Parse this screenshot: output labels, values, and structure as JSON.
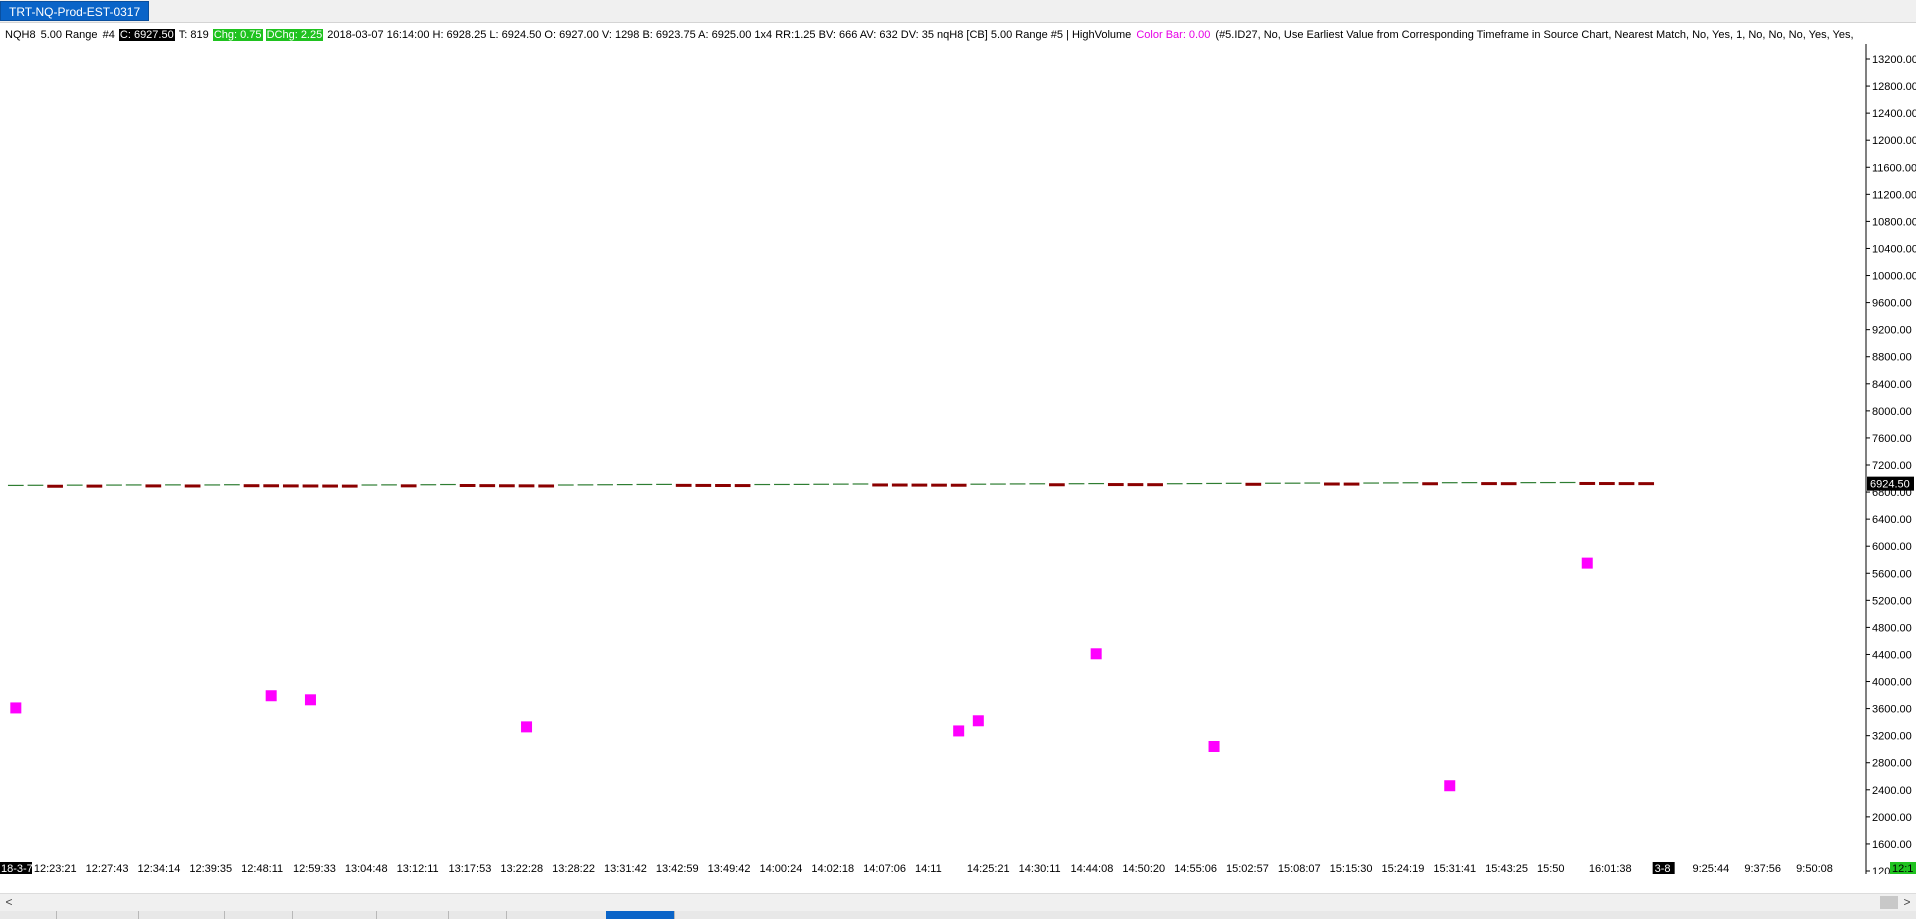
{
  "window": {
    "tab_title": "TRT-NQ-Prod-EST-0317"
  },
  "infoline": {
    "symbol": "NQH8",
    "range": "5.00 Range",
    "num": "#4",
    "close": "C: 6927.50",
    "ticks": "T: 819",
    "chg": "Chg: 0.75",
    "dchg": "DChg: 2.25",
    "details": "2018-03-07 16:14:00 H: 6928.25 L: 6924.50 O: 6927.00 V: 1298 B: 6923.75 A: 6925.00 1x4 RR:1.25 BV: 666 AV: 632 DV: 35 nqH8 [CB]  5.00 Range  #5 | HighVolume",
    "colorbar": "Color Bar: 0.00",
    "study": "(#5.ID27, No, Use Earliest Value from Corresponding Timeframe in Source Chart, Nearest Match, No, Yes, 1, No, No, No, Yes, Yes,"
  },
  "chart_data": {
    "type": "scatter",
    "ylim": [
      1200,
      13200
    ],
    "y_ticks": [
      "13200.00",
      "12800.00",
      "12400.00",
      "12000.00",
      "11600.00",
      "11200.00",
      "10800.00",
      "10400.00",
      "10000.00",
      "9600.00",
      "9200.00",
      "8800.00",
      "8400.00",
      "8000.00",
      "7600.00",
      "7200.00",
      "6800.00",
      "6400.00",
      "6000.00",
      "5600.00",
      "5200.00",
      "4800.00",
      "4400.00",
      "4000.00",
      "3600.00",
      "3200.00",
      "2800.00",
      "2400.00",
      "2000.00",
      "1600.00",
      "1200.00"
    ],
    "last_price_label": "6924.50",
    "last_price": 6924.5,
    "x_labels": [
      "18-3-7",
      "12:23:21",
      "12:27:43",
      "12:34:14",
      "12:39:35",
      "12:48:11",
      "12:59:33",
      "13:04:48",
      "13:12:11",
      "13:17:53",
      "13:22:28",
      "13:28:22",
      "13:31:42",
      "13:42:59",
      "13:49:42",
      "14:00:24",
      "14:02:18",
      "14:07:06",
      "14:11",
      "14:25:21",
      "14:30:11",
      "14:44:08",
      "14:50:20",
      "14:55:06",
      "15:02:57",
      "15:08:07",
      "15:15:30",
      "15:24:19",
      "15:31:41",
      "15:43:25",
      "15:50",
      "16:01:38",
      "3-8",
      "9:25:44",
      "9:37:56",
      "9:50:08",
      "12:1"
    ],
    "price_series": [
      6885,
      6887,
      6886,
      6889,
      6888,
      6890,
      6892,
      6891,
      6893,
      6890,
      6892,
      6895,
      6894,
      6893,
      6891,
      6890,
      6889,
      6888,
      6891,
      6893,
      6892,
      6895,
      6898,
      6897,
      6895,
      6893,
      6892,
      6890,
      6891,
      6893,
      6895,
      6897,
      6899,
      6900,
      6899,
      6898,
      6897,
      6896,
      6898,
      6899,
      6900,
      6902,
      6904,
      6906,
      6905,
      6904,
      6903,
      6902,
      6901,
      6903,
      6905,
      6907,
      6909,
      6908,
      6910,
      6912,
      6911,
      6910,
      6909,
      6910,
      6912,
      6914,
      6916,
      6915,
      6917,
      6918,
      6920,
      6919,
      6918,
      6920,
      6922,
      6924,
      6923,
      6925,
      6926,
      6925,
      6924,
      6926,
      6927,
      6928,
      6927,
      6926,
      6925,
      6924.5
    ],
    "markers": {
      "name": "HighVolume",
      "color": "#ff00ff",
      "points": [
        {
          "bar": 0,
          "y": 3610
        },
        {
          "bar": 13,
          "y": 3790
        },
        {
          "bar": 15,
          "y": 3730
        },
        {
          "bar": 26,
          "y": 3330
        },
        {
          "bar": 48,
          "y": 3270
        },
        {
          "bar": 49,
          "y": 3420
        },
        {
          "bar": 55,
          "y": 4410
        },
        {
          "bar": 61,
          "y": 3040
        },
        {
          "bar": 73,
          "y": 2460
        },
        {
          "bar": 80,
          "y": 5750
        }
      ]
    },
    "colors": {
      "up": "#2e7d32",
      "down": "#8b0000",
      "axis_text": "#000000",
      "price_label_bg": "#000000",
      "date_label_bg": "#000000",
      "current_time_bg": "#1fc21f"
    },
    "grid": false
  },
  "scrollbar": {
    "left_arrow": "<",
    "right_arrow": ">"
  }
}
